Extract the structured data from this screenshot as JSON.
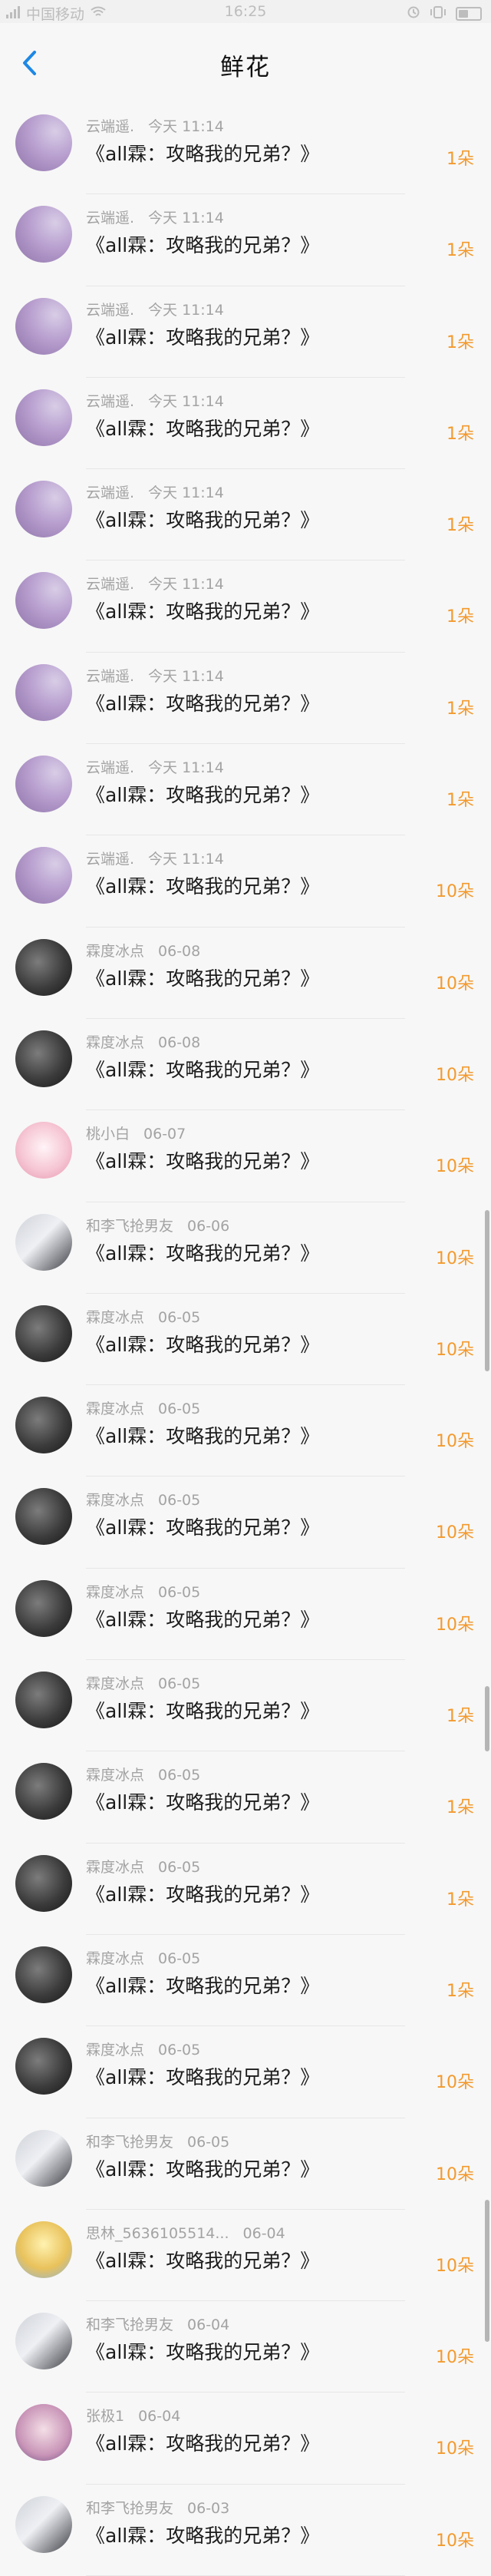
{
  "status_bar": {
    "carrier": "中国移动",
    "time": "16:25",
    "signal_icon": "signal-icon",
    "wifi_icon": "wifi-icon",
    "battery_icon": "battery-icon"
  },
  "nav": {
    "title": "鲜花",
    "back_icon": "chevron-left-icon",
    "accent": "#1e88e5"
  },
  "colors": {
    "count": "#f39a2e",
    "name": "#a3a3a3",
    "title": "#1c1c1c"
  },
  "items": [
    {
      "name": "云端遥.",
      "time": "今天 11:14",
      "title": "《all霖：攻略我的兄弟？》",
      "count": "1朵",
      "avatar": "cloud-avatar"
    },
    {
      "name": "云端遥.",
      "time": "今天 11:14",
      "title": "《all霖：攻略我的兄弟？》",
      "count": "1朵",
      "avatar": "cloud-avatar"
    },
    {
      "name": "云端遥.",
      "time": "今天 11:14",
      "title": "《all霖：攻略我的兄弟？》",
      "count": "1朵",
      "avatar": "cloud-avatar"
    },
    {
      "name": "云端遥.",
      "time": "今天 11:14",
      "title": "《all霖：攻略我的兄弟？》",
      "count": "1朵",
      "avatar": "cloud-avatar"
    },
    {
      "name": "云端遥.",
      "time": "今天 11:14",
      "title": "《all霖：攻略我的兄弟？》",
      "count": "1朵",
      "avatar": "cloud-avatar"
    },
    {
      "name": "云端遥.",
      "time": "今天 11:14",
      "title": "《all霖：攻略我的兄弟？》",
      "count": "1朵",
      "avatar": "cloud-avatar"
    },
    {
      "name": "云端遥.",
      "time": "今天 11:14",
      "title": "《all霖：攻略我的兄弟？》",
      "count": "1朵",
      "avatar": "cloud-avatar"
    },
    {
      "name": "云端遥.",
      "time": "今天 11:14",
      "title": "《all霖：攻略我的兄弟？》",
      "count": "1朵",
      "avatar": "cloud-avatar"
    },
    {
      "name": "云端遥.",
      "time": "今天 11:14",
      "title": "《all霖：攻略我的兄弟？》",
      "count": "10朵",
      "avatar": "cloud-avatar"
    },
    {
      "name": "霖度冰点",
      "time": "06-08",
      "title": "《all霖：攻略我的兄弟？》",
      "count": "10朵",
      "avatar": "dark-avatar"
    },
    {
      "name": "霖度冰点",
      "time": "06-08",
      "title": "《all霖：攻略我的兄弟？》",
      "count": "10朵",
      "avatar": "dark-avatar"
    },
    {
      "name": "桃小白",
      "time": "06-07",
      "title": "《all霖：攻略我的兄弟？》",
      "count": "10朵",
      "avatar": "pink-avatar"
    },
    {
      "name": "和李飞抢男友",
      "time": "06-06",
      "title": "《all霖：攻略我的兄弟？》",
      "count": "10朵",
      "avatar": "couple-avatar"
    },
    {
      "name": "霖度冰点",
      "time": "06-05",
      "title": "《all霖：攻略我的兄弟？》",
      "count": "10朵",
      "avatar": "dark-avatar"
    },
    {
      "name": "霖度冰点",
      "time": "06-05",
      "title": "《all霖：攻略我的兄弟？》",
      "count": "10朵",
      "avatar": "dark-avatar"
    },
    {
      "name": "霖度冰点",
      "time": "06-05",
      "title": "《all霖：攻略我的兄弟？》",
      "count": "10朵",
      "avatar": "dark-avatar"
    },
    {
      "name": "霖度冰点",
      "time": "06-05",
      "title": "《all霖：攻略我的兄弟？》",
      "count": "10朵",
      "avatar": "dark-avatar"
    },
    {
      "name": "霖度冰点",
      "time": "06-05",
      "title": "《all霖：攻略我的兄弟？》",
      "count": "1朵",
      "avatar": "dark-avatar"
    },
    {
      "name": "霖度冰点",
      "time": "06-05",
      "title": "《all霖：攻略我的兄弟？》",
      "count": "1朵",
      "avatar": "dark-avatar"
    },
    {
      "name": "霖度冰点",
      "time": "06-05",
      "title": "《all霖：攻略我的兄弟？》",
      "count": "1朵",
      "avatar": "dark-avatar"
    },
    {
      "name": "霖度冰点",
      "time": "06-05",
      "title": "《all霖：攻略我的兄弟？》",
      "count": "1朵",
      "avatar": "dark-avatar"
    },
    {
      "name": "霖度冰点",
      "time": "06-05",
      "title": "《all霖：攻略我的兄弟？》",
      "count": "10朵",
      "avatar": "dark-avatar"
    },
    {
      "name": "和李飞抢男友",
      "time": "06-05",
      "title": "《all霖：攻略我的兄弟？》",
      "count": "10朵",
      "avatar": "couple-avatar"
    },
    {
      "name": "思林_5636105514...",
      "time": "06-04",
      "title": "《all霖：攻略我的兄弟？》",
      "count": "10朵",
      "avatar": "yellow-avatar"
    },
    {
      "name": "和李飞抢男友",
      "time": "06-04",
      "title": "《all霖：攻略我的兄弟？》",
      "count": "10朵",
      "avatar": "couple-avatar"
    },
    {
      "name": "张极1",
      "time": "06-04",
      "title": "《all霖：攻略我的兄弟？》",
      "count": "10朵",
      "avatar": "girl-avatar"
    },
    {
      "name": "和李飞抢男友",
      "time": "06-03",
      "title": "《all霖：攻略我的兄弟？》",
      "count": "10朵",
      "avatar": "couple-avatar"
    }
  ]
}
